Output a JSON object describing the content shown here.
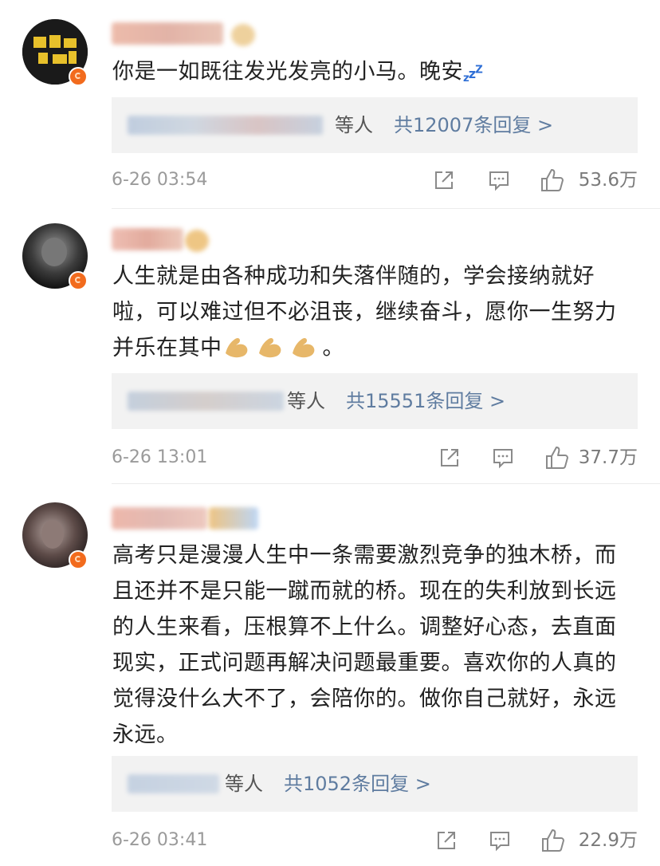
{
  "comments": [
    {
      "text": "你是一如既往发光发亮的小马。晚安",
      "reply_summary": "等人",
      "reply_more": "共12007条回复 >",
      "time": "6-26 03:54",
      "likes": "53.6万",
      "avatar_color": "#1c1c1c"
    },
    {
      "text": "人生就是由各种成功和失落伴随的，学会接纳就好啦，可以难过但不必沮丧，继续奋斗，愿你一生努力并乐在其中",
      "text_tail": "。",
      "reply_summary": "等人",
      "reply_more": "共15551条回复 >",
      "time": "6-26 13:01",
      "likes": "37.7万",
      "avatar_color": "#4a4a4a"
    },
    {
      "text": "高考只是漫漫人生中一条需要激烈竞争的独木桥，而且还并不是只能一蹴而就的桥。现在的失利放到长远的人生来看，压根算不上什么。调整好心态，去直面现实，正式问题再解决问题最重要。喜欢你的人真的觉得没什么大不了，会陪你的。做你自己就好，永远永远。",
      "reply_summary": "等人",
      "reply_more": "共1052条回复 >",
      "time": "6-26 03:41",
      "likes": "22.9万",
      "avatar_color": "#5a4a48"
    }
  ],
  "colors": {
    "link": "#5f7ca0",
    "meta": "#9a9a9a",
    "reply_bg": "#f2f2f2",
    "badge": "#f26b1d"
  }
}
